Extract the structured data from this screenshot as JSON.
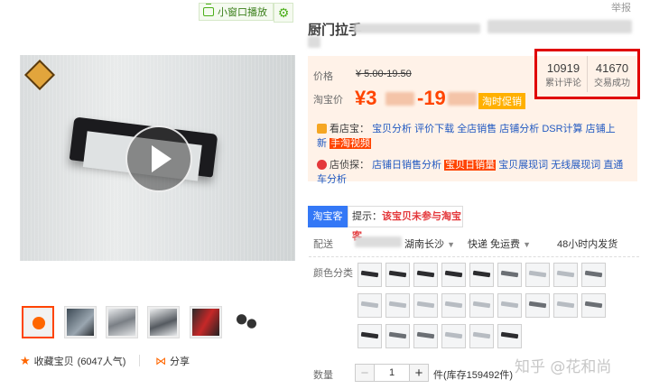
{
  "top_bar": {
    "mini_play_label": "小窗口播放",
    "report_label": "举报"
  },
  "product": {
    "title": "厨门拉手"
  },
  "price": {
    "label": "价格",
    "original": "¥ 5.00-19.50",
    "tb_label": "淘宝价",
    "current_left": "¥3",
    "current_right": "-19",
    "promo_badge": "淘时促销"
  },
  "stats": {
    "reviews_count": "10919",
    "reviews_label": "累计评论",
    "sales_count": "41670",
    "sales_label": "交易成功"
  },
  "toolbar_seller": {
    "prefix": "看店宝：",
    "items": [
      "宝贝分析",
      "评价下载",
      "全店销售",
      "店铺分析",
      "DSR计算",
      "店铺上新"
    ],
    "tag": "手淘视频"
  },
  "toolbar_shop": {
    "prefix": "店侦探：",
    "items": [
      "店铺日销售分析"
    ],
    "highlight": "宝贝日销量",
    "items2": [
      "宝贝展现词",
      "无线展现词",
      "直通车分析"
    ]
  },
  "taoke": {
    "tab": "淘宝客",
    "tip_prefix": "提示：",
    "tip_text": "该宝贝未参与淘宝客"
  },
  "delivery": {
    "label": "配送",
    "location": "湖南长沙",
    "express": "快递 免运费",
    "ship_time": "48小时内发货"
  },
  "sku": {
    "label": "颜色分类"
  },
  "quantity": {
    "label": "数量",
    "value": "1",
    "stock": "件(库存159492件)"
  },
  "left_panel": {
    "fav_label": "收藏宝贝",
    "fav_count": "(6047人气)",
    "share_label": "分享"
  },
  "watermark": "知乎 @花和尚",
  "colors": {
    "accent": "#ff4400",
    "stat_border": "#e00000",
    "link": "#2159c1",
    "tk_blue": "#3478f6"
  }
}
